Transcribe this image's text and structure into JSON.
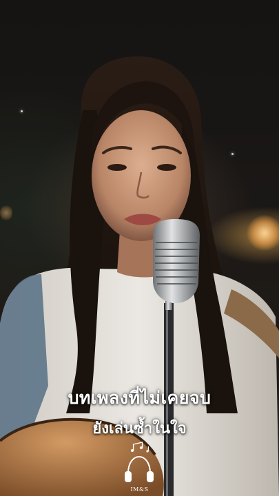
{
  "video": {
    "lyrics": {
      "line_1": "บทเพลงที่ไม่เคยจบ",
      "line_2": "ยังเล่นซ้ำในใจ"
    },
    "logo": {
      "text": "IM&S",
      "icon": "headphones-music-icon"
    },
    "colors": {
      "text": "#ffffff",
      "bokeh": "#ffc070",
      "hair": "#1d1510",
      "skin": "#c9987a",
      "shirt": "#e6e4e0",
      "guitar": "#b07a48",
      "mic": "#b9bcbf"
    }
  }
}
